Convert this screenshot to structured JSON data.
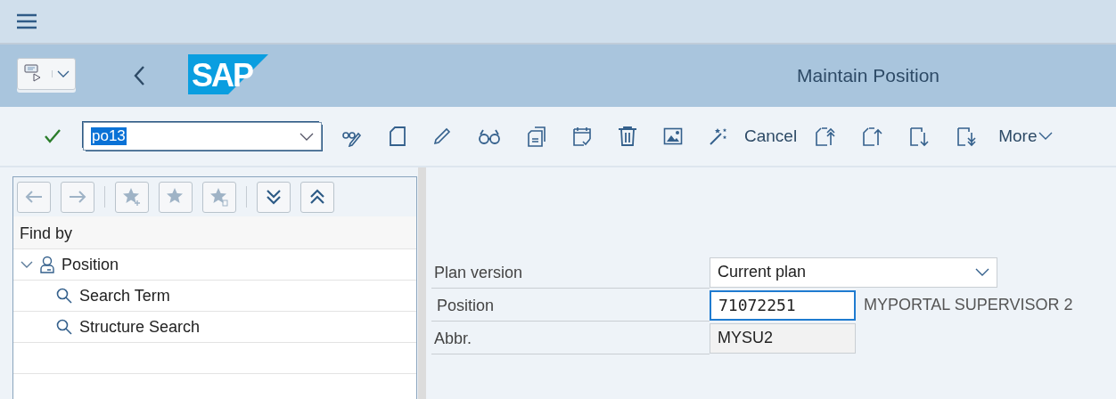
{
  "header": {
    "logo": "SAP",
    "title": "Maintain Position"
  },
  "toolbar": {
    "command": {
      "value": "po13",
      "text_selected": true
    },
    "cancel": "Cancel",
    "more": "More"
  },
  "nav_buttons": [
    {
      "kind": "back",
      "disabled": true
    },
    {
      "kind": "forward",
      "disabled": true
    },
    {
      "kind": "star-add",
      "disabled": true
    },
    {
      "kind": "star",
      "disabled": true
    },
    {
      "kind": "star-delete",
      "disabled": true
    },
    {
      "kind": "expand",
      "disabled": false
    },
    {
      "kind": "collapse",
      "disabled": false
    }
  ],
  "tree": {
    "heading": "Find by",
    "items": [
      {
        "label": "Position",
        "expanded": true,
        "children": [
          {
            "label": "Search Term"
          },
          {
            "label": "Structure Search"
          }
        ]
      }
    ]
  },
  "form": {
    "fields": [
      {
        "label": "Plan version",
        "kind": "dropdown",
        "value": "Current plan",
        "focused": false
      },
      {
        "label": "Position",
        "kind": "input",
        "value": "71072251",
        "focused": true,
        "description": "MYPORTAL SUPERVISOR 2"
      },
      {
        "label": "Abbr.",
        "kind": "readonly",
        "value": "MYSU2",
        "focused": false
      }
    ]
  }
}
